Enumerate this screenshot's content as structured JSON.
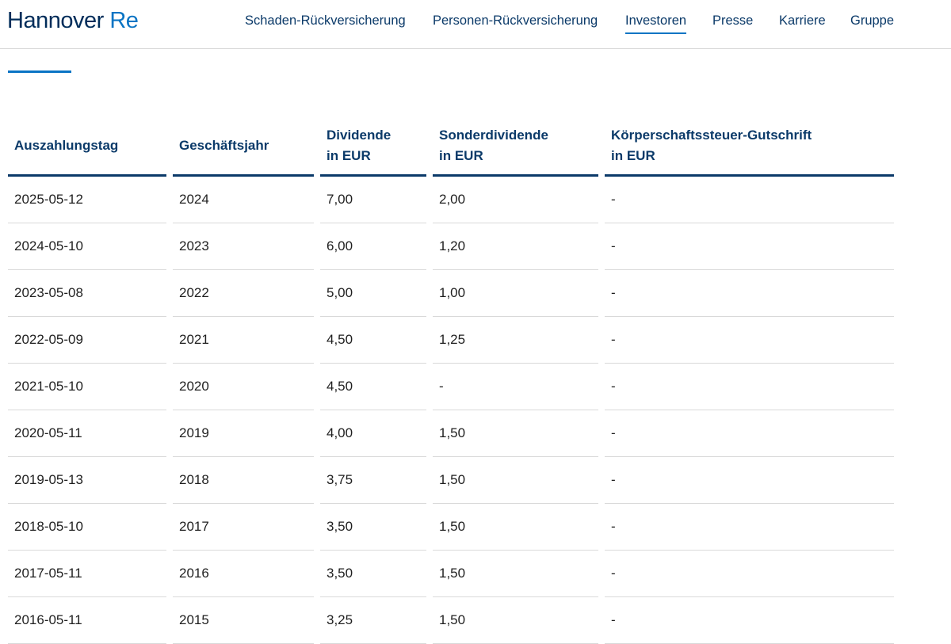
{
  "header": {
    "logo": {
      "brand": "Hannover",
      "re": "Re"
    },
    "nav": [
      {
        "label": "Schaden-Rückversicherung",
        "active": false
      },
      {
        "label": "Personen-Rückversicherung",
        "active": false
      },
      {
        "label": "Investoren",
        "active": true
      },
      {
        "label": "Presse",
        "active": false
      },
      {
        "label": "Karriere",
        "active": false
      },
      {
        "label": "Gruppe",
        "active": false
      }
    ]
  },
  "table": {
    "headers": [
      [
        "Auszahlungstag"
      ],
      [
        "Geschäftsjahr"
      ],
      [
        "Dividende",
        "in EUR"
      ],
      [
        "Sonderdividende",
        "in EUR"
      ],
      [
        "Körperschaftssteuer-Gutschrift",
        "in EUR"
      ]
    ],
    "rows": [
      [
        "2025-05-12",
        "2024",
        "7,00",
        "2,00",
        "-"
      ],
      [
        "2024-05-10",
        "2023",
        "6,00",
        "1,20",
        "-"
      ],
      [
        "2023-05-08",
        "2022",
        "5,00",
        "1,00",
        "-"
      ],
      [
        "2022-05-09",
        "2021",
        "4,50",
        "1,25",
        "-"
      ],
      [
        "2021-05-10",
        "2020",
        "4,50",
        "-",
        "-"
      ],
      [
        "2020-05-11",
        "2019",
        "4,00",
        "1,50",
        "-"
      ],
      [
        "2019-05-13",
        "2018",
        "3,75",
        "1,50",
        "-"
      ],
      [
        "2018-05-10",
        "2017",
        "3,50",
        "1,50",
        "-"
      ],
      [
        "2017-05-11",
        "2016",
        "3,50",
        "1,50",
        "-"
      ],
      [
        "2016-05-11",
        "2015",
        "3,25",
        "1,50",
        "-"
      ]
    ]
  },
  "colors": {
    "navy": "#0b3a69",
    "accent": "#0a74c4"
  }
}
